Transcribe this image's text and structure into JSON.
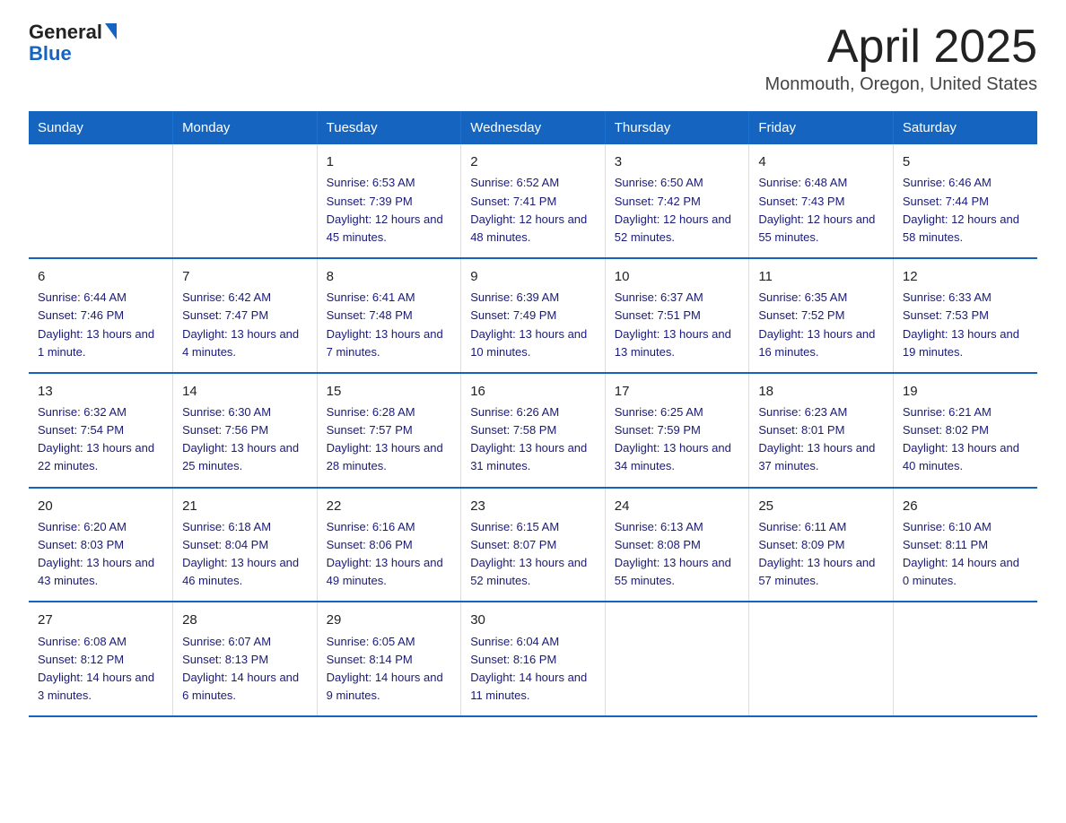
{
  "logo": {
    "line1": "General",
    "line2": "Blue"
  },
  "title": "April 2025",
  "subtitle": "Monmouth, Oregon, United States",
  "days_header": [
    "Sunday",
    "Monday",
    "Tuesday",
    "Wednesday",
    "Thursday",
    "Friday",
    "Saturday"
  ],
  "weeks": [
    [
      {
        "num": "",
        "sunrise": "",
        "sunset": "",
        "daylight": ""
      },
      {
        "num": "",
        "sunrise": "",
        "sunset": "",
        "daylight": ""
      },
      {
        "num": "1",
        "sunrise": "Sunrise: 6:53 AM",
        "sunset": "Sunset: 7:39 PM",
        "daylight": "Daylight: 12 hours and 45 minutes."
      },
      {
        "num": "2",
        "sunrise": "Sunrise: 6:52 AM",
        "sunset": "Sunset: 7:41 PM",
        "daylight": "Daylight: 12 hours and 48 minutes."
      },
      {
        "num": "3",
        "sunrise": "Sunrise: 6:50 AM",
        "sunset": "Sunset: 7:42 PM",
        "daylight": "Daylight: 12 hours and 52 minutes."
      },
      {
        "num": "4",
        "sunrise": "Sunrise: 6:48 AM",
        "sunset": "Sunset: 7:43 PM",
        "daylight": "Daylight: 12 hours and 55 minutes."
      },
      {
        "num": "5",
        "sunrise": "Sunrise: 6:46 AM",
        "sunset": "Sunset: 7:44 PM",
        "daylight": "Daylight: 12 hours and 58 minutes."
      }
    ],
    [
      {
        "num": "6",
        "sunrise": "Sunrise: 6:44 AM",
        "sunset": "Sunset: 7:46 PM",
        "daylight": "Daylight: 13 hours and 1 minute."
      },
      {
        "num": "7",
        "sunrise": "Sunrise: 6:42 AM",
        "sunset": "Sunset: 7:47 PM",
        "daylight": "Daylight: 13 hours and 4 minutes."
      },
      {
        "num": "8",
        "sunrise": "Sunrise: 6:41 AM",
        "sunset": "Sunset: 7:48 PM",
        "daylight": "Daylight: 13 hours and 7 minutes."
      },
      {
        "num": "9",
        "sunrise": "Sunrise: 6:39 AM",
        "sunset": "Sunset: 7:49 PM",
        "daylight": "Daylight: 13 hours and 10 minutes."
      },
      {
        "num": "10",
        "sunrise": "Sunrise: 6:37 AM",
        "sunset": "Sunset: 7:51 PM",
        "daylight": "Daylight: 13 hours and 13 minutes."
      },
      {
        "num": "11",
        "sunrise": "Sunrise: 6:35 AM",
        "sunset": "Sunset: 7:52 PM",
        "daylight": "Daylight: 13 hours and 16 minutes."
      },
      {
        "num": "12",
        "sunrise": "Sunrise: 6:33 AM",
        "sunset": "Sunset: 7:53 PM",
        "daylight": "Daylight: 13 hours and 19 minutes."
      }
    ],
    [
      {
        "num": "13",
        "sunrise": "Sunrise: 6:32 AM",
        "sunset": "Sunset: 7:54 PM",
        "daylight": "Daylight: 13 hours and 22 minutes."
      },
      {
        "num": "14",
        "sunrise": "Sunrise: 6:30 AM",
        "sunset": "Sunset: 7:56 PM",
        "daylight": "Daylight: 13 hours and 25 minutes."
      },
      {
        "num": "15",
        "sunrise": "Sunrise: 6:28 AM",
        "sunset": "Sunset: 7:57 PM",
        "daylight": "Daylight: 13 hours and 28 minutes."
      },
      {
        "num": "16",
        "sunrise": "Sunrise: 6:26 AM",
        "sunset": "Sunset: 7:58 PM",
        "daylight": "Daylight: 13 hours and 31 minutes."
      },
      {
        "num": "17",
        "sunrise": "Sunrise: 6:25 AM",
        "sunset": "Sunset: 7:59 PM",
        "daylight": "Daylight: 13 hours and 34 minutes."
      },
      {
        "num": "18",
        "sunrise": "Sunrise: 6:23 AM",
        "sunset": "Sunset: 8:01 PM",
        "daylight": "Daylight: 13 hours and 37 minutes."
      },
      {
        "num": "19",
        "sunrise": "Sunrise: 6:21 AM",
        "sunset": "Sunset: 8:02 PM",
        "daylight": "Daylight: 13 hours and 40 minutes."
      }
    ],
    [
      {
        "num": "20",
        "sunrise": "Sunrise: 6:20 AM",
        "sunset": "Sunset: 8:03 PM",
        "daylight": "Daylight: 13 hours and 43 minutes."
      },
      {
        "num": "21",
        "sunrise": "Sunrise: 6:18 AM",
        "sunset": "Sunset: 8:04 PM",
        "daylight": "Daylight: 13 hours and 46 minutes."
      },
      {
        "num": "22",
        "sunrise": "Sunrise: 6:16 AM",
        "sunset": "Sunset: 8:06 PM",
        "daylight": "Daylight: 13 hours and 49 minutes."
      },
      {
        "num": "23",
        "sunrise": "Sunrise: 6:15 AM",
        "sunset": "Sunset: 8:07 PM",
        "daylight": "Daylight: 13 hours and 52 minutes."
      },
      {
        "num": "24",
        "sunrise": "Sunrise: 6:13 AM",
        "sunset": "Sunset: 8:08 PM",
        "daylight": "Daylight: 13 hours and 55 minutes."
      },
      {
        "num": "25",
        "sunrise": "Sunrise: 6:11 AM",
        "sunset": "Sunset: 8:09 PM",
        "daylight": "Daylight: 13 hours and 57 minutes."
      },
      {
        "num": "26",
        "sunrise": "Sunrise: 6:10 AM",
        "sunset": "Sunset: 8:11 PM",
        "daylight": "Daylight: 14 hours and 0 minutes."
      }
    ],
    [
      {
        "num": "27",
        "sunrise": "Sunrise: 6:08 AM",
        "sunset": "Sunset: 8:12 PM",
        "daylight": "Daylight: 14 hours and 3 minutes."
      },
      {
        "num": "28",
        "sunrise": "Sunrise: 6:07 AM",
        "sunset": "Sunset: 8:13 PM",
        "daylight": "Daylight: 14 hours and 6 minutes."
      },
      {
        "num": "29",
        "sunrise": "Sunrise: 6:05 AM",
        "sunset": "Sunset: 8:14 PM",
        "daylight": "Daylight: 14 hours and 9 minutes."
      },
      {
        "num": "30",
        "sunrise": "Sunrise: 6:04 AM",
        "sunset": "Sunset: 8:16 PM",
        "daylight": "Daylight: 14 hours and 11 minutes."
      },
      {
        "num": "",
        "sunrise": "",
        "sunset": "",
        "daylight": ""
      },
      {
        "num": "",
        "sunrise": "",
        "sunset": "",
        "daylight": ""
      },
      {
        "num": "",
        "sunrise": "",
        "sunset": "",
        "daylight": ""
      }
    ]
  ]
}
